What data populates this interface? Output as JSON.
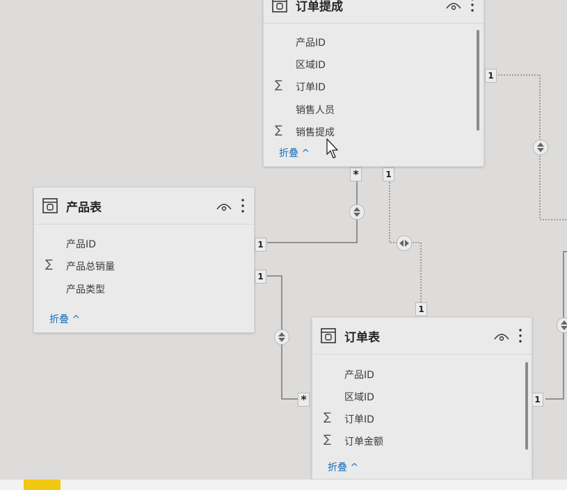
{
  "tables": {
    "commission": {
      "title": "订单提成",
      "fields": [
        {
          "name": "产品ID",
          "sigma": ""
        },
        {
          "name": "区域ID",
          "sigma": ""
        },
        {
          "name": "订单ID",
          "sigma": "∑"
        },
        {
          "name": "销售人员",
          "sigma": ""
        },
        {
          "name": "销售提成",
          "sigma": "∑"
        }
      ],
      "collapse_label": "折叠 ^"
    },
    "product": {
      "title": "产品表",
      "fields": [
        {
          "name": "产品ID",
          "sigma": ""
        },
        {
          "name": "产品总销量",
          "sigma": "∑"
        },
        {
          "name": "产品类型",
          "sigma": ""
        }
      ],
      "collapse_label": "折叠 ^"
    },
    "orders": {
      "title": "订单表",
      "fields": [
        {
          "name": "产品ID",
          "sigma": ""
        },
        {
          "name": "区域ID",
          "sigma": ""
        },
        {
          "name": "订单ID",
          "sigma": "∑"
        },
        {
          "name": "订单金额",
          "sigma": "∑"
        }
      ],
      "collapse_label": "折叠 ^"
    }
  },
  "cardinality": {
    "one": "1",
    "many": "*"
  },
  "colors": {
    "canvas": "#dddcdb",
    "card": "#eaeaea",
    "collapse_link": "#1b6fb8",
    "accent_tab": "#f2c811"
  },
  "icons": [
    "table-icon",
    "eye-icon",
    "more-options-icon",
    "sigma-icon",
    "cross-filter-single-icon",
    "cross-filter-both-icon",
    "mouse-cursor-icon"
  ]
}
